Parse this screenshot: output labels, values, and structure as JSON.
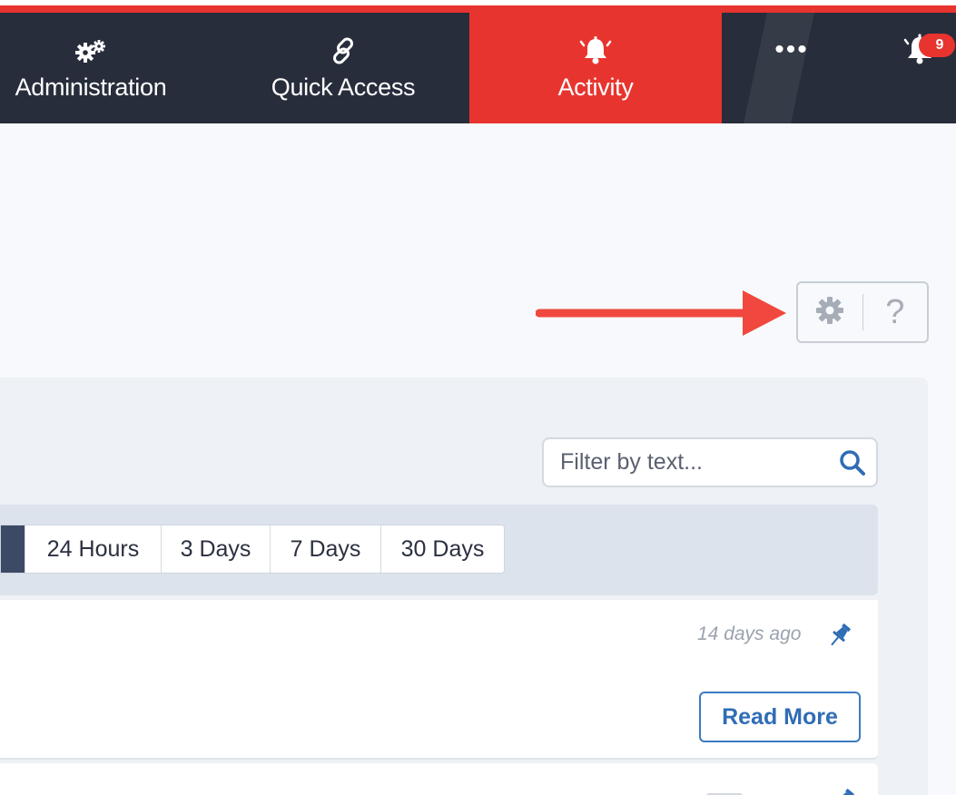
{
  "nav": {
    "administration": "Administration",
    "quick_access": "Quick Access",
    "activity": "Activity",
    "more": "•••",
    "notification_count": "9"
  },
  "toolbar": {
    "help_label": "?"
  },
  "filter": {
    "placeholder": "Filter by text..."
  },
  "time_range": {
    "options": [
      "24 Hours",
      "3 Days",
      "7 Days",
      "30 Days"
    ]
  },
  "activity_items": [
    {
      "time": "14 days ago",
      "read_more": "Read More"
    }
  ],
  "colors": {
    "nav_bg": "#272d3b",
    "accent_red": "#e8342f",
    "link_blue": "#2f6db5",
    "annotation_arrow": "#f0483e"
  },
  "icons": {
    "administration": "gears-icon",
    "quick_access": "link-icon",
    "activity": "bell-ringing-icon",
    "notifications": "bell-icon",
    "settings": "gear-icon",
    "search": "search-icon",
    "pin": "pin-icon"
  }
}
